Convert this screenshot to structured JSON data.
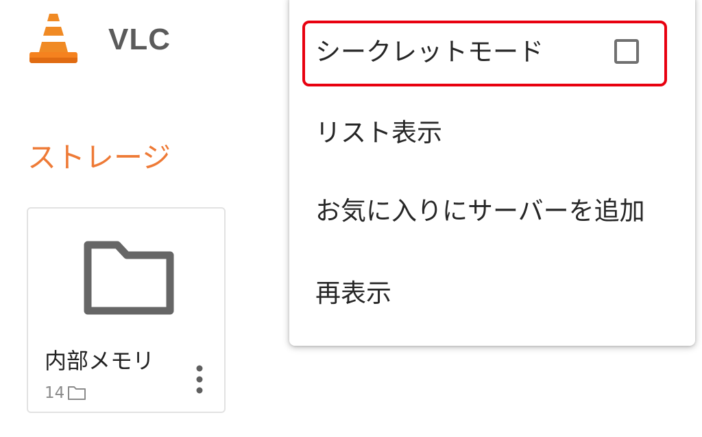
{
  "header": {
    "app_name": "VLC",
    "logo_icon": "vlc-cone-icon"
  },
  "storage": {
    "section_title": "ストレージ",
    "cards": [
      {
        "name": "内部メモリ",
        "count": "14",
        "icon": "folder-icon",
        "count_icon": "folder-icon",
        "more_icon": "more-vert-icon"
      }
    ]
  },
  "menu": {
    "items": [
      {
        "label": "シークレットモード",
        "checked": false
      },
      {
        "label": "リスト表示"
      },
      {
        "label": "お気に入りにサーバーを追加"
      },
      {
        "label": "再表示"
      }
    ]
  },
  "colors": {
    "accent": "#ee7a36",
    "highlight_border": "#e8000f",
    "icon_gray": "#666666",
    "title_gray": "#5b5b5b"
  }
}
